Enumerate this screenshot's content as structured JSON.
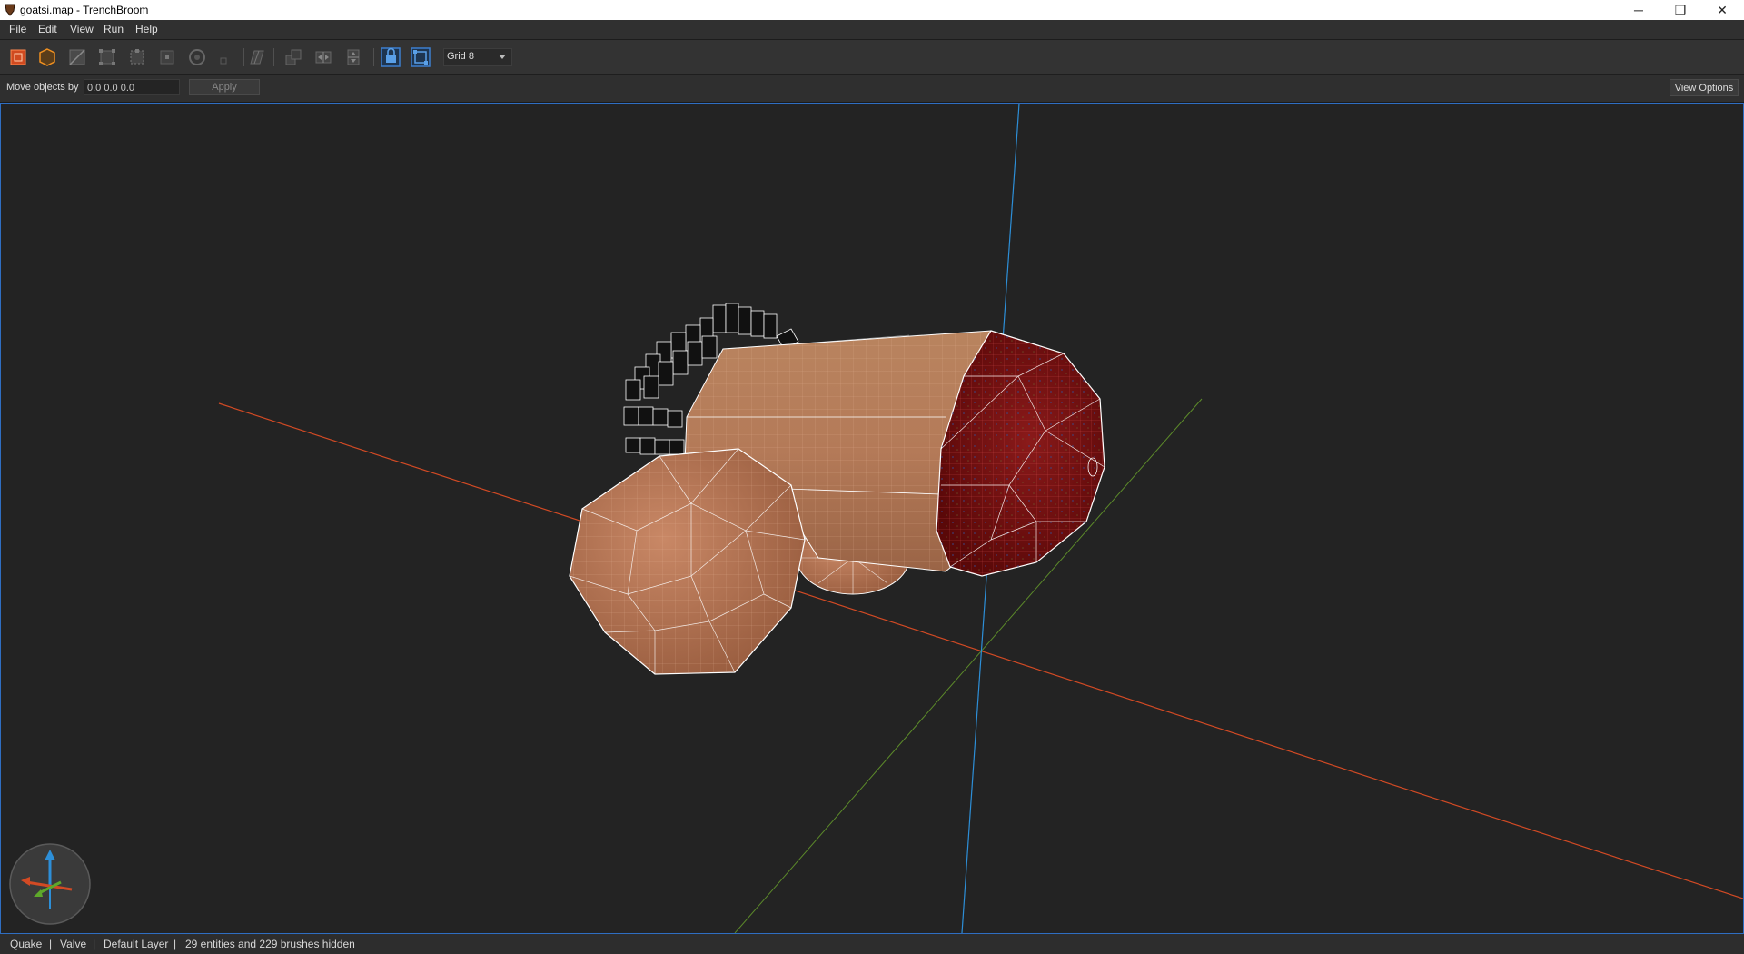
{
  "window": {
    "title": "goatsi.map - TrenchBroom",
    "minimize_glyph": "─",
    "maximize_glyph": "❐",
    "close_glyph": "✕"
  },
  "menu": [
    "File",
    "Edit",
    "View",
    "Run",
    "Help"
  ],
  "toolbar": {
    "grid_value": "Grid 8",
    "icons": [
      "selection-tool-icon",
      "brush-tool-icon",
      "clip-tool-icon",
      "vertex-tool-icon",
      "edge-tool-icon",
      "face-tool-icon",
      "rotate-tool-icon",
      "scale-tool-icon",
      "shear-tool-icon",
      "duplicate-icon",
      "flip-horizontal-icon",
      "flip-vertical-icon",
      "texture-lock-icon",
      "uv-lock-icon"
    ]
  },
  "move_bar": {
    "label": "Move objects by",
    "value": "0.0 0.0 0.0",
    "apply_label": "Apply",
    "view_options_label": "View Options"
  },
  "status": {
    "game": "Quake",
    "sep1": "|",
    "format": "Valve",
    "sep2": "|",
    "layer": "Default Layer",
    "sep3": "|",
    "hidden": "29 entities and 229 brushes hidden"
  },
  "colors": {
    "x_axis": "#d24a24",
    "y_axis": "#5c8a2a",
    "z_axis": "#2d8fd8",
    "selection_accent": "#2f6ec2",
    "brush_texture": "#b07a58",
    "red_texture": "#7a1010"
  }
}
